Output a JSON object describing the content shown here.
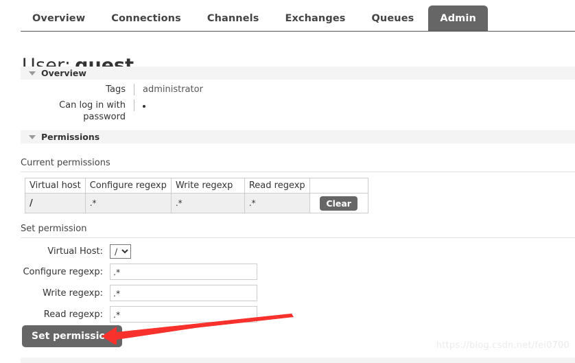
{
  "nav": {
    "tabs": [
      {
        "label": "Overview",
        "active": false
      },
      {
        "label": "Connections",
        "active": false
      },
      {
        "label": "Channels",
        "active": false
      },
      {
        "label": "Exchanges",
        "active": false
      },
      {
        "label": "Queues",
        "active": false
      },
      {
        "label": "Admin",
        "active": true
      }
    ]
  },
  "page": {
    "title_label": "User:",
    "title_value": "guest"
  },
  "overview_section": {
    "header": "Overview",
    "rows": [
      {
        "key": "Tags",
        "value": "administrator"
      },
      {
        "key": "Can log in with password",
        "value": ""
      }
    ]
  },
  "permissions_section": {
    "header": "Permissions",
    "current_label": "Current permissions",
    "table": {
      "columns": [
        "Virtual host",
        "Configure regexp",
        "Write regexp",
        "Read regexp",
        ""
      ],
      "rows": [
        {
          "virtual_host": "/",
          "configure": ".*",
          "write": ".*",
          "read": ".*",
          "action": "Clear"
        }
      ]
    },
    "set_label": "Set permission",
    "form": {
      "virtual_host_label": "Virtual Host:",
      "virtual_host_value": "/",
      "virtual_host_options": [
        "/"
      ],
      "configure_label": "Configure regexp:",
      "configure_value": ".*",
      "write_label": "Write regexp:",
      "write_value": ".*",
      "read_label": "Read regexp:",
      "read_value": ".*",
      "submit_label": "Set permission"
    }
  },
  "annotation": {
    "arrow_color": "#f8312c"
  },
  "watermark": {
    "text": "https://blog.csdn.net/fei0700"
  }
}
